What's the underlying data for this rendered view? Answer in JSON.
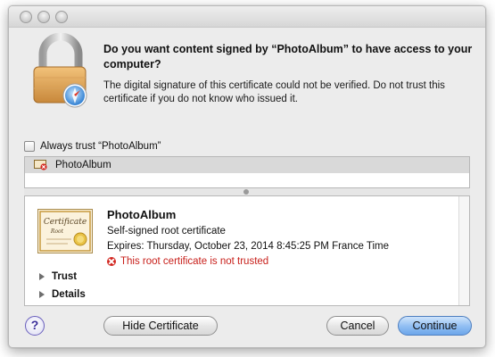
{
  "dialog": {
    "question": "Do you want content signed by “PhotoAlbum” to have access to your computer?",
    "explanation": "The digital signature of this certificate could not be verified. Do not trust this certificate if you do not know who issued it."
  },
  "always_trust": {
    "label": "Always trust “PhotoAlbum”",
    "checked": false
  },
  "chain": {
    "items": [
      {
        "label": "PhotoAlbum",
        "icon": "certificate-error-icon"
      }
    ]
  },
  "certificate": {
    "name": "PhotoAlbum",
    "type": "Self-signed root certificate",
    "expires": "Expires: Thursday, October 23, 2014 8:45:25 PM France Time",
    "status": "This root certificate is not trusted",
    "image_title": "Certificate",
    "image_subtitle": "Root",
    "status_color": "#c8201b"
  },
  "sections": {
    "trust_label": "Trust",
    "details_label": "Details"
  },
  "buttons": {
    "help": "?",
    "hide_certificate": "Hide Certificate",
    "cancel": "Cancel",
    "continue": "Continue"
  },
  "colors": {
    "accent": "#6da6ea",
    "error": "#d2261f"
  }
}
